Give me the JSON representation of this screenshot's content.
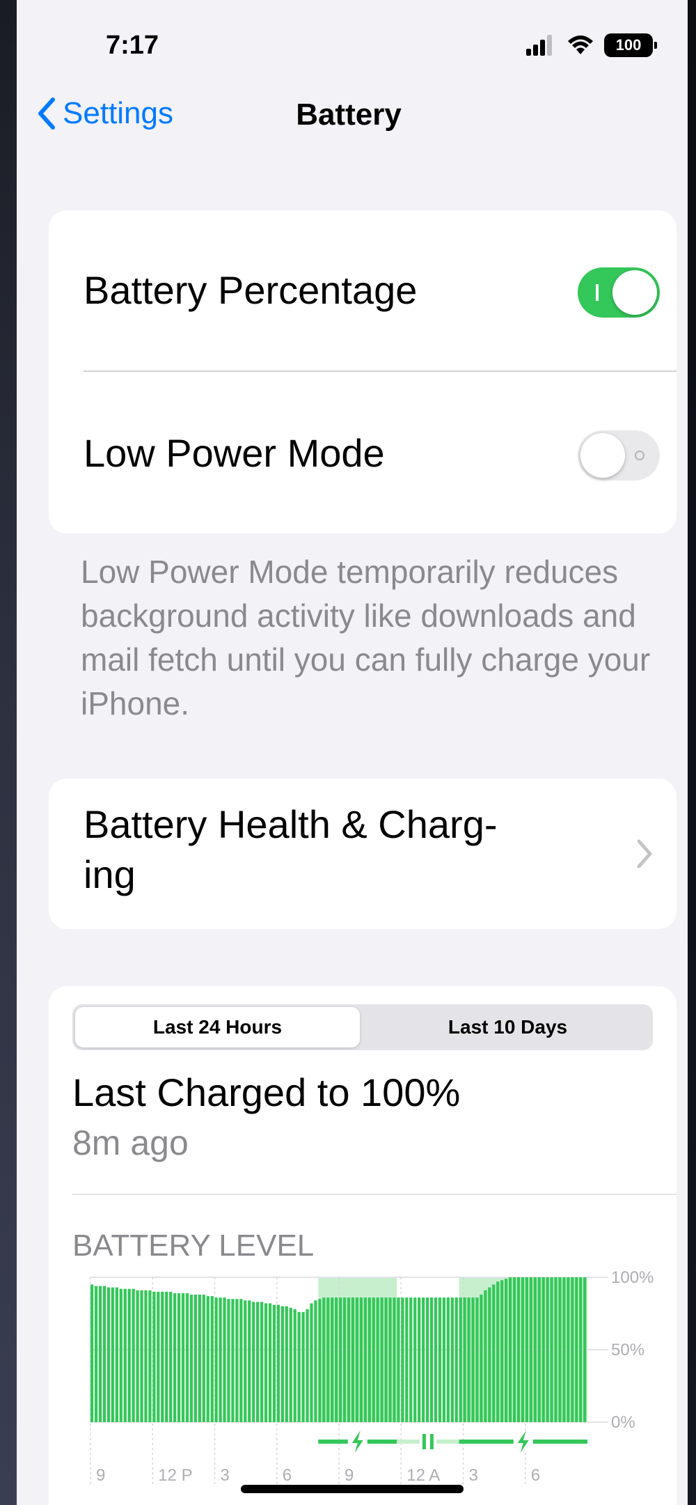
{
  "status_bar": {
    "time": "7:17",
    "battery": "100"
  },
  "nav": {
    "back_label": "Settings",
    "title": "Battery"
  },
  "settings": {
    "battery_percentage": {
      "label": "Battery Percentage",
      "on": true
    },
    "low_power_mode": {
      "label": "Low Power Mode",
      "on": false
    },
    "low_power_note": "Low Power Mode temporarily reduces background activity like downloads and mail fetch until you can fully charge your iPhone."
  },
  "health": {
    "label_line1": "Battery Health & Charg-",
    "label_line2": "ing"
  },
  "usage": {
    "tabs": [
      {
        "label": "Last 24 Hours",
        "selected": true
      },
      {
        "label": "Last 10 Days",
        "selected": false
      }
    ],
    "last_charged_title": "Last Charged to 100%",
    "last_charged_ago": "8m ago",
    "battery_level_title": "BATTERY LEVEL"
  },
  "colors": {
    "green": "#34c759",
    "light_green": "#c7efce",
    "accent": "#007aff"
  },
  "chart_data": {
    "type": "bar",
    "title": "BATTERY LEVEL",
    "x_tick_labels": [
      "9",
      "12 P",
      "3",
      "6",
      "9",
      "12 A",
      "3",
      "6"
    ],
    "y_tick_labels": [
      "100%",
      "50%",
      "0%"
    ],
    "ylim": [
      0,
      100
    ],
    "grid": true,
    "series": [
      {
        "values": [
          95,
          94,
          94,
          94,
          93,
          93,
          93,
          92,
          92,
          92,
          92,
          91,
          91,
          91,
          91,
          90,
          90,
          90,
          90,
          90,
          89,
          89,
          89,
          89,
          88,
          88,
          88,
          88,
          87,
          87,
          86,
          86,
          86,
          85,
          85,
          85,
          85,
          84,
          84,
          83,
          83,
          83,
          82,
          82,
          81,
          81,
          80,
          80,
          79,
          78,
          76,
          76,
          78,
          82,
          84,
          85,
          86,
          86,
          86,
          86,
          86,
          86,
          86,
          86,
          86,
          86,
          86,
          86,
          86,
          86,
          86,
          86,
          86,
          86,
          86,
          86,
          86,
          86,
          86,
          86,
          86,
          86,
          86,
          86,
          86,
          86,
          86,
          86,
          86,
          86,
          86,
          86,
          86,
          86,
          88,
          91,
          93,
          95,
          97,
          98,
          99,
          100,
          100,
          100,
          100,
          100,
          100,
          100,
          100,
          100,
          100,
          100,
          100,
          100,
          100,
          100,
          100,
          100,
          100,
          100
        ]
      }
    ],
    "charging_periods": [
      {
        "start_bar": 55,
        "end_bar": 74,
        "state": "charging"
      },
      {
        "start_bar": 74,
        "end_bar": 89,
        "state": "paused"
      },
      {
        "start_bar": 89,
        "end_bar": 120,
        "state": "charging"
      }
    ]
  }
}
